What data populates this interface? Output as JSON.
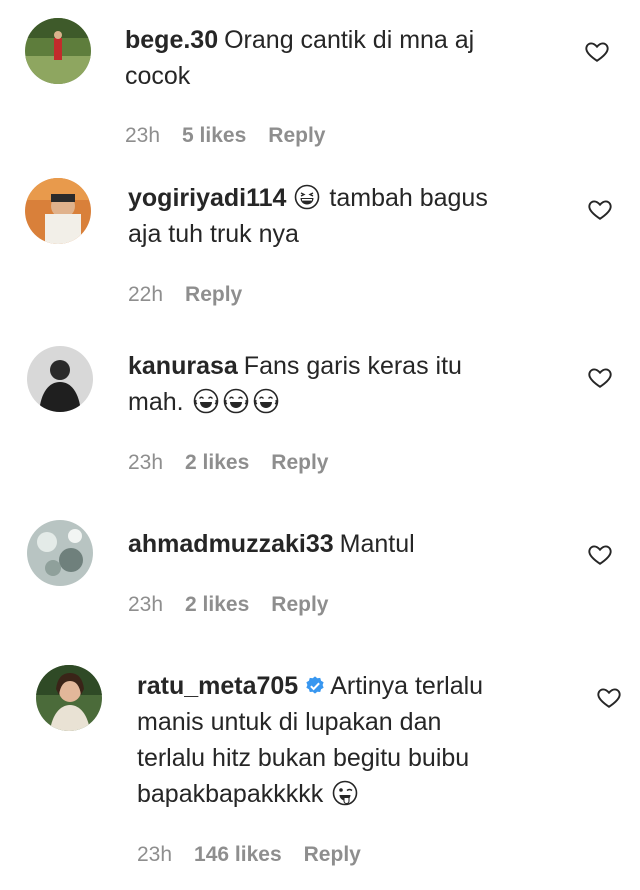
{
  "comments": [
    {
      "username": "bege.30",
      "text_line1": "Orang cantik di mna aj",
      "text_line2": "cocok",
      "time": "23h",
      "likes": "5 likes",
      "reply": "Reply"
    },
    {
      "username": "yogiriyadi114",
      "text_after_emoji": "tambah bagus",
      "text_line2": "aja tuh truk nya",
      "time": "22h",
      "reply": "Reply",
      "emoji": "grinning-squint-face"
    },
    {
      "username": "kanurasa",
      "text_line1": "Fans garis keras itu",
      "text_line2": "mah.",
      "time": "23h",
      "likes": "2 likes",
      "reply": "Reply",
      "emoji": "tears-of-joy-face"
    },
    {
      "username": "ahmadmuzzaki33",
      "text_line1": "Mantul",
      "time": "23h",
      "likes": "2 likes",
      "reply": "Reply"
    },
    {
      "username": "ratu_meta705",
      "text_line1": "Artinya terlalu",
      "text_line2": "manis untuk di lupakan dan",
      "text_line3": "terlalu hitz bukan begitu buibu",
      "text_line4": "bapakbapakkkkk",
      "time": "23h",
      "likes": "146 likes",
      "reply": "Reply",
      "verified": true,
      "emoji": "winking-tongue-face"
    }
  ],
  "colors": {
    "text": "#262626",
    "meta": "#8e8e8e",
    "verified": "#3897f0"
  },
  "icons": {
    "like": "heart-outline-icon",
    "verified": "verified-badge-icon"
  }
}
